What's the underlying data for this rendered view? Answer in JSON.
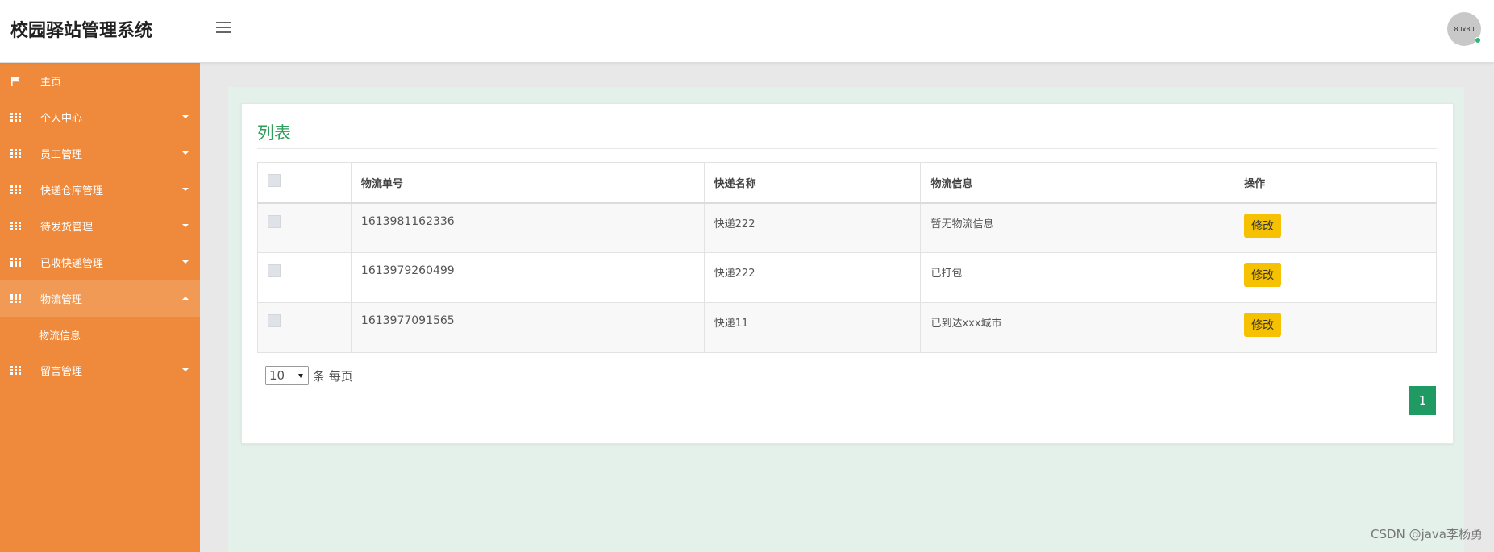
{
  "header": {
    "title": "校园驿站管理系统",
    "avatar_text": "80x80"
  },
  "sidebar": {
    "items": [
      {
        "label": "主页",
        "icon": "flag-icon"
      },
      {
        "label": "个人中心",
        "icon": "grid-icon"
      },
      {
        "label": "员工管理",
        "icon": "grid-icon"
      },
      {
        "label": "快递仓库管理",
        "icon": "grid-icon"
      },
      {
        "label": "待发货管理",
        "icon": "grid-icon"
      },
      {
        "label": "已收快递管理",
        "icon": "grid-icon"
      },
      {
        "label": "物流管理",
        "icon": "grid-icon"
      },
      {
        "label": "留言管理",
        "icon": "grid-icon"
      }
    ],
    "sub_item": "物流信息"
  },
  "card": {
    "title": "列表"
  },
  "table": {
    "columns": [
      "物流单号",
      "快递名称",
      "物流信息",
      "操作"
    ],
    "rows": [
      {
        "number": "1613981162336",
        "name": "快递222",
        "info": "暂无物流信息",
        "action": "修改"
      },
      {
        "number": "1613979260499",
        "name": "快递222",
        "info": "已打包",
        "action": "修改"
      },
      {
        "number": "1613977091565",
        "name": "快递11",
        "info": "已到达xxx城市",
        "action": "修改"
      }
    ]
  },
  "pager": {
    "page_size": "10",
    "per_page_text": "条 每页",
    "current_page": "1"
  },
  "watermark": "CSDN @java李杨勇",
  "colors": {
    "sidebar": "#ef8a3c",
    "title": "#2e9e5b",
    "edit_button": "#f5c100",
    "page_button": "#1e9a62"
  }
}
